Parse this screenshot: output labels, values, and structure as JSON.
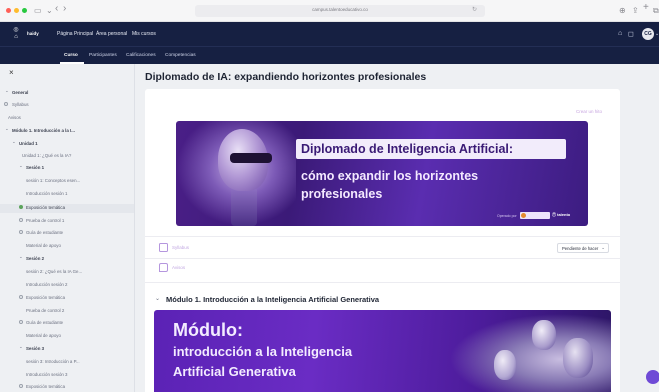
{
  "browser": {
    "url": "campus.talentoeducativo.co",
    "back_icon": "‹",
    "forward_icon": "›",
    "reload_icon": "↻",
    "share_icon": "⇪",
    "newtab_icon": "+",
    "tabs_icon": "⧉",
    "download_icon": "⊕"
  },
  "topnav": {
    "brand": "haidy",
    "links": [
      "Página Principal",
      "Área personal",
      "Mis cursos"
    ],
    "avatar_initials": "CG"
  },
  "subnav": {
    "tabs": [
      "Curso",
      "Participantes",
      "Calificaciones",
      "Competencias"
    ]
  },
  "sidebar": {
    "items": [
      "General",
      "Syllabus",
      "Avisos",
      "Módulo 1. Introducción a la I...",
      "Unidad 1",
      "Unidad 1: ¿Qué es la IA?",
      "Sesión 1",
      "sesión 1: Conceptos esen...",
      "Introducción sesión 1",
      "Exposición temática",
      "Prueba de control 1",
      "Guía de estudiante",
      "Material de apoyo",
      "Sesión 2",
      "sesión 2: ¿Qué es la IA Ge...",
      "Introducción sesión 2",
      "Exposición temática",
      "Prueba de control 2",
      "Guía de estudiante",
      "Material de apoyo",
      "Sesión 3",
      "sesión 3: Introducción a P...",
      "Introducción sesión 3",
      "Exposición temática"
    ]
  },
  "main": {
    "title": "Diplomado de IA: expandiendo horizontes profesionales",
    "create_link": "Crear un hito",
    "banner1": {
      "title": "Diplomado de Inteligencia Artificial:",
      "subtitle_line1": "cómo expandir los horizontes",
      "subtitle_line2": "profesionales",
      "credit": "Operado por",
      "logo2": "Ⓣ talento"
    },
    "activities": [
      {
        "label": "Syllabus",
        "icon": "document-icon"
      },
      {
        "label": "Avisos",
        "icon": "chat-icon"
      }
    ],
    "status_select": "Pendiente de hacer",
    "section_title": "Módulo 1. Introducción a la Inteligencia Artificial Generativa",
    "banner2": {
      "line1": "Módulo:",
      "line2": "introducción a la Inteligencia",
      "line3": "Artificial Generativa"
    }
  },
  "colors": {
    "nav_bg": "#162042",
    "accent_purple": "#5b22b5",
    "link_lilac": "#c2a8e2",
    "done_green": "#5ca35c"
  }
}
